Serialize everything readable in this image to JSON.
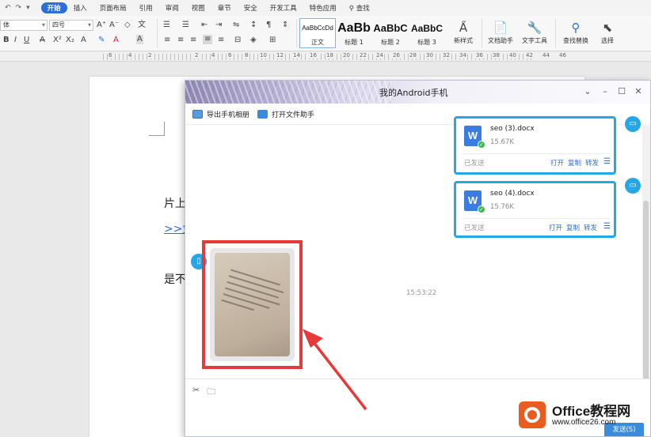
{
  "menubar": {
    "quick_access": [
      "↶",
      "↷",
      "▾"
    ],
    "tabs": [
      "开始",
      "插入",
      "页面布局",
      "引用",
      "审阅",
      "视图",
      "章节",
      "安全",
      "开发工具",
      "特色应用"
    ],
    "search_label": "查找"
  },
  "toolbar": {
    "font_name": "体",
    "font_size": "四号",
    "styles": [
      {
        "sample": "AaBbCcDd",
        "name": "正文"
      },
      {
        "sample": "AaBb",
        "name": "标题 1"
      },
      {
        "sample": "AaBbC",
        "name": "标题 2"
      },
      {
        "sample": "AaBbC",
        "name": "标题 3"
      }
    ],
    "new_style": "新样式",
    "doc_helper": "文档助手",
    "text_tools": "文字工具",
    "find_replace": "查找替换",
    "select": "选择"
  },
  "ruler": {
    "numbers": [
      "6",
      "4",
      "2",
      "2",
      "4",
      "6",
      "8",
      "10",
      "12",
      "14",
      "16",
      "18",
      "20",
      "22",
      "24",
      "26",
      "28",
      "30",
      "32",
      "34",
      "36",
      "38",
      "40",
      "42",
      "44",
      "46"
    ]
  },
  "document": {
    "line1": "片上",
    "link": ">>免",
    "line3": "是不"
  },
  "dialog": {
    "title": "我的Android手机",
    "export_album": "导出手机相册",
    "open_file_helper": "打开文件助手",
    "files": [
      {
        "name": "seo (3).docx",
        "size": "15.67K",
        "status": "已发送",
        "actions": [
          "打开",
          "复制",
          "转发"
        ]
      },
      {
        "name": "seo (4).docx",
        "size": "15.76K",
        "status": "已发送",
        "actions": [
          "打开",
          "复制",
          "转发"
        ]
      }
    ],
    "timestamp": "15:53:22",
    "send_label": "发送(S)"
  },
  "watermark": {
    "title": "Office教程网",
    "url": "www.office26.com"
  },
  "colors": {
    "accent": "#2b6fd6",
    "card_border": "#27a6e6",
    "highlight": "#e63a3a"
  }
}
